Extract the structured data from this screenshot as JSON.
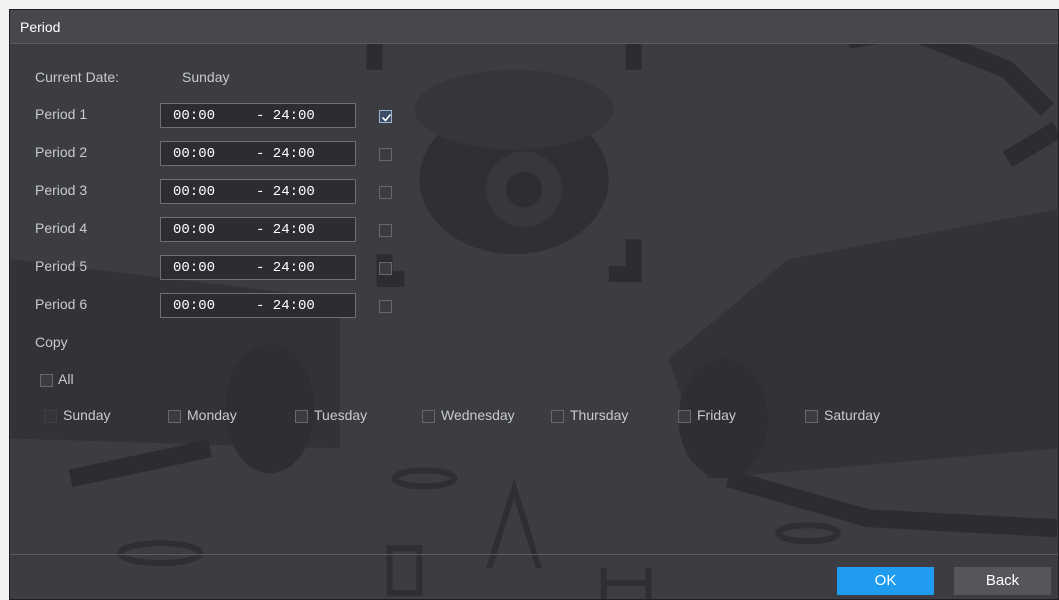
{
  "dialog": {
    "title": "Period"
  },
  "current_date": {
    "label": "Current Date:",
    "value": "Sunday"
  },
  "periods": [
    {
      "label": "Period 1",
      "start": "00:00",
      "end": "- 24:00",
      "enabled": true
    },
    {
      "label": "Period 2",
      "start": "00:00",
      "end": "- 24:00",
      "enabled": false
    },
    {
      "label": "Period 3",
      "start": "00:00",
      "end": "- 24:00",
      "enabled": false
    },
    {
      "label": "Period 4",
      "start": "00:00",
      "end": "- 24:00",
      "enabled": false
    },
    {
      "label": "Period 5",
      "start": "00:00",
      "end": "- 24:00",
      "enabled": false
    },
    {
      "label": "Period 6",
      "start": "00:00",
      "end": "- 24:00",
      "enabled": false
    }
  ],
  "copy": {
    "label": "Copy",
    "all_label": "All",
    "days": [
      "Sunday",
      "Monday",
      "Tuesday",
      "Wednesday",
      "Thursday",
      "Friday",
      "Saturday"
    ]
  },
  "buttons": {
    "ok": "OK",
    "back": "Back"
  },
  "colors": {
    "accent": "#1f9cf0",
    "panel": "#3b3d42"
  }
}
